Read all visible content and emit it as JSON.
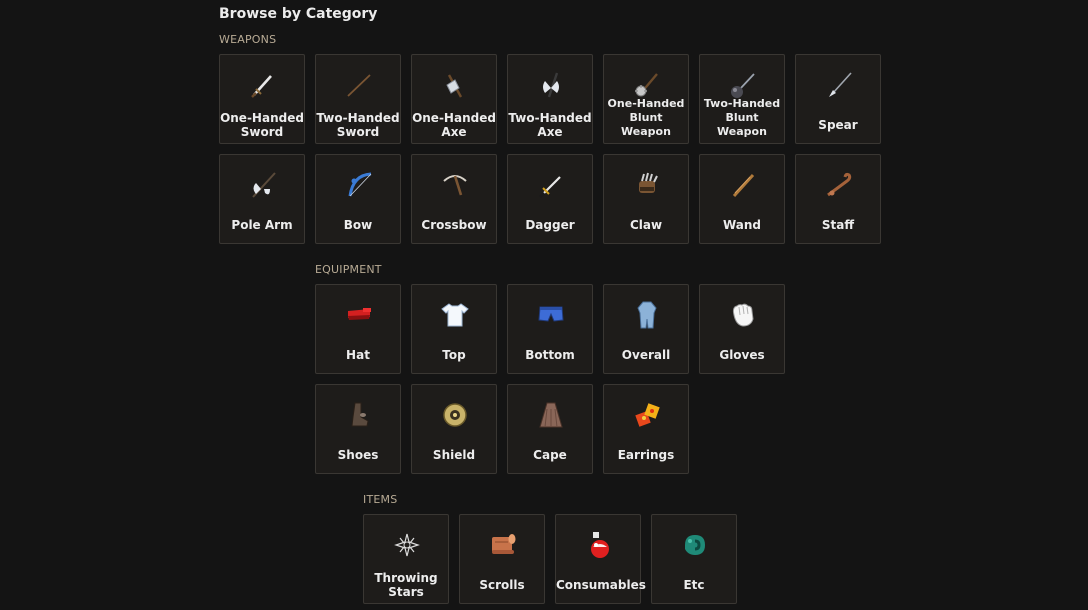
{
  "page": {
    "title": "Browse by Category"
  },
  "sections": {
    "weapons": {
      "label": "WEAPONS",
      "items": [
        {
          "label": "One-Handed Sword",
          "icon": "one-handed-sword-icon"
        },
        {
          "label": "Two-Handed Sword",
          "icon": "two-handed-sword-icon"
        },
        {
          "label": "One-Handed Axe",
          "icon": "one-handed-axe-icon"
        },
        {
          "label": "Two-Handed Axe",
          "icon": "two-handed-axe-icon"
        },
        {
          "label": "One-Handed Blunt Weapon",
          "icon": "one-handed-blunt-weapon-icon"
        },
        {
          "label": "Two-Handed Blunt Weapon",
          "icon": "two-handed-blunt-weapon-icon"
        },
        {
          "label": "Spear",
          "icon": "spear-icon"
        },
        {
          "label": "Pole Arm",
          "icon": "pole-arm-icon"
        },
        {
          "label": "Bow",
          "icon": "bow-icon"
        },
        {
          "label": "Crossbow",
          "icon": "crossbow-icon"
        },
        {
          "label": "Dagger",
          "icon": "dagger-icon"
        },
        {
          "label": "Claw",
          "icon": "claw-icon"
        },
        {
          "label": "Wand",
          "icon": "wand-icon"
        },
        {
          "label": "Staff",
          "icon": "staff-icon"
        }
      ]
    },
    "equipment": {
      "label": "EQUIPMENT",
      "items": [
        {
          "label": "Hat",
          "icon": "hat-icon"
        },
        {
          "label": "Top",
          "icon": "top-icon"
        },
        {
          "label": "Bottom",
          "icon": "bottom-icon"
        },
        {
          "label": "Overall",
          "icon": "overall-icon"
        },
        {
          "label": "Gloves",
          "icon": "gloves-icon"
        },
        {
          "label": "Shoes",
          "icon": "shoes-icon"
        },
        {
          "label": "Shield",
          "icon": "shield-icon"
        },
        {
          "label": "Cape",
          "icon": "cape-icon"
        },
        {
          "label": "Earrings",
          "icon": "earrings-icon"
        }
      ]
    },
    "items": {
      "label": "ITEMS",
      "items": [
        {
          "label": "Throwing Stars",
          "icon": "throwing-stars-icon"
        },
        {
          "label": "Scrolls",
          "icon": "scrolls-icon"
        },
        {
          "label": "Consumables",
          "icon": "consumables-icon"
        },
        {
          "label": "Etc",
          "icon": "etc-icon"
        }
      ]
    }
  },
  "colors": {
    "background": "#141414",
    "tile_background": "#1e1c1a",
    "tile_border": "#3a3733",
    "section_label": "#b8ab95",
    "text": "#ededed"
  }
}
